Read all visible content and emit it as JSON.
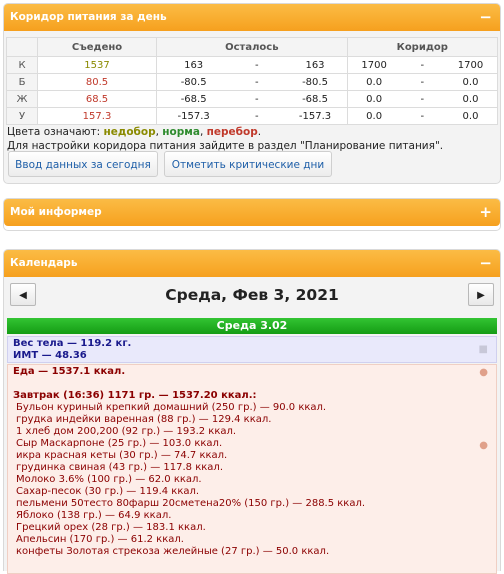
{
  "corridor": {
    "title": "Коридор питания за день",
    "collapse_glyph": "−",
    "headers": [
      "",
      "Съедено",
      "Осталось",
      "Коридор"
    ],
    "dash": "-",
    "rows": [
      {
        "label": "К",
        "eaten": "1537",
        "left_a": "163",
        "left_b": "163",
        "corr_a": "1700",
        "corr_b": "1700",
        "color": "#8a8a00"
      },
      {
        "label": "Б",
        "eaten": "80.5",
        "left_a": "-80.5",
        "left_b": "-80.5",
        "corr_a": "0.0",
        "corr_b": "0.0",
        "color": "#c0392b"
      },
      {
        "label": "Ж",
        "eaten": "68.5",
        "left_a": "-68.5",
        "left_b": "-68.5",
        "corr_a": "0.0",
        "corr_b": "0.0",
        "color": "#c0392b"
      },
      {
        "label": "У",
        "eaten": "157.3",
        "left_a": "-157.3",
        "left_b": "-157.3",
        "corr_a": "0.0",
        "corr_b": "0.0",
        "color": "#c0392b"
      }
    ],
    "legend_prefix": "Цвета означают: ",
    "legend_under": "недобор",
    "legend_sep": ", ",
    "legend_norm": "норма",
    "legend_over": "перебор",
    "legend_end": ".",
    "legend_colors": {
      "under": "#8a8a00",
      "norm": "#2e8b2e",
      "over": "#c0392b"
    },
    "hint": "Для настройки коридора питания зайдите в раздел \"Планирование питания\".",
    "btn_today": "Ввод данных за сегодня",
    "btn_critical": "Отметить критические дни"
  },
  "informer": {
    "title": "Мой информер",
    "expand_glyph": "+"
  },
  "calendar": {
    "title": "Календарь",
    "collapse_glyph": "−",
    "prev": "◀",
    "next": "▶",
    "date": "Среда, Фев 3, 2021",
    "day_header": "Среда 3.02",
    "weight_line": "Вес тела — 119.2 кг.",
    "bmi_line": "ИМТ — 48.36",
    "food_total": "Еда — 1537.1 ккал.",
    "meal": "Завтрак (16:36) 1171 гр. — 1537.20 ккал.:",
    "items": [
      "Бульон куриный крепкий домашний (250 гр.) — 90.0 ккал.",
      "грудка индейки варенная (88 гр.) — 129.4 ккал.",
      "1 хлеб дом 200,200 (92 гр.) — 193.2 ккал.",
      "Сыр Маскарпоне (25 гр.) — 103.0 ккал.",
      "икра красная кеты (30 гр.) — 74.7 ккал.",
      "грудинка свиная (43 гр.) — 117.8 ккал.",
      "Молоко 3.6% (100 гр.) — 62.0 ккал.",
      "Сахар-песок (30 гр.) — 119.4 ккал.",
      "пельмени 50тесто 80фарш 20сметена20% (150 гр.) — 288.5 ккал.",
      "Яблоко (138 гр.) — 64.9 ккал.",
      "Грецкий орех (28 гр.) — 183.1 ккал.",
      "Апельсин (170 гр.) — 61.2 ккал.",
      "конфеты Золотая стрекоза желейные (27 гр.) — 50.0 ккал."
    ]
  }
}
